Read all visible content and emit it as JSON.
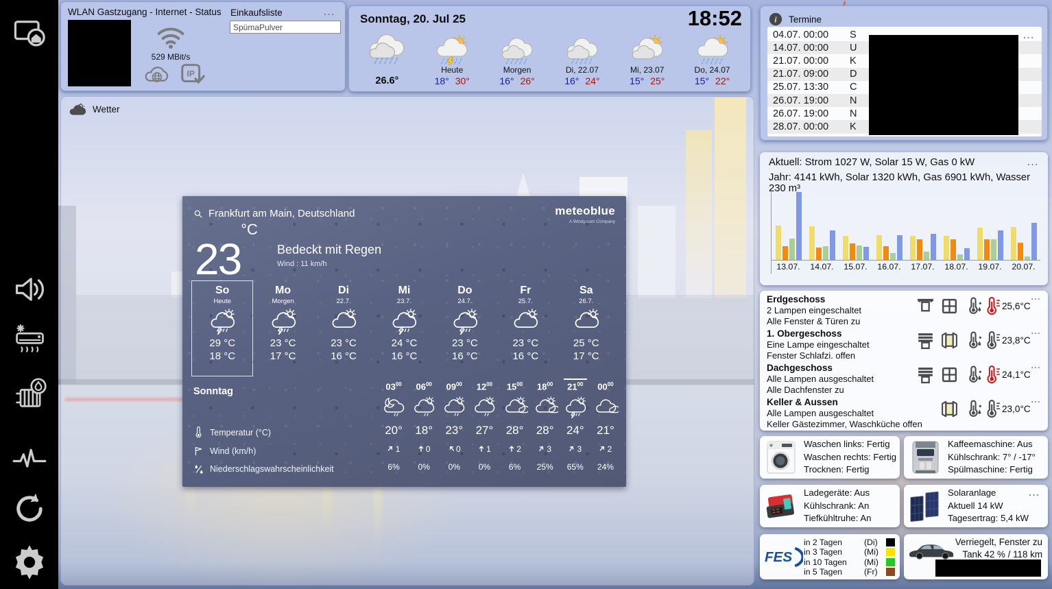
{
  "sidebar": {
    "items": [
      {
        "name": "sidebar-item-home-screen",
        "icon": "screen-home-icon"
      },
      {
        "name": "sidebar-item-audio",
        "icon": "speaker-icon"
      },
      {
        "name": "sidebar-item-climate",
        "icon": "ac-icon"
      },
      {
        "name": "sidebar-item-heating",
        "icon": "radiator-icon"
      },
      {
        "name": "sidebar-item-status",
        "icon": "pulse-icon"
      },
      {
        "name": "sidebar-item-reload",
        "icon": "refresh-icon"
      },
      {
        "name": "sidebar-item-settings",
        "icon": "gear-icon"
      }
    ]
  },
  "wlan_panel": {
    "title": "WLAN Gastzugang - Internet - Status",
    "speed": "529 MBit/s",
    "icons": {
      "wifi": "wifi-icon",
      "internet": "cloud-globe-icon",
      "ip": "ip-check-icon"
    }
  },
  "shopping": {
    "title": "Einkaufsliste",
    "menu": "...",
    "items": [
      "SpümaPulver"
    ]
  },
  "clock_panel": {
    "date": "Sonntag, 20. Jul 25",
    "time": "18:52",
    "current": {
      "icon": "t-rain-heavy",
      "temp": "26.6°"
    },
    "days": [
      {
        "label": "Heute",
        "min": "18°",
        "max": "30°",
        "icon": "t-sun-rain-thunder"
      },
      {
        "label": "Morgen",
        "min": "16°",
        "max": "26°",
        "icon": "t-clouds-rain"
      },
      {
        "label": "Di, 22.07",
        "min": "16°",
        "max": "24°",
        "icon": "t-clouds-rain"
      },
      {
        "label": "Mi, 23.07",
        "min": "15°",
        "max": "25°",
        "icon": "t-sun-clouds"
      },
      {
        "label": "Do, 24.07",
        "min": "15°",
        "max": "22°",
        "icon": "t-sun-rain"
      }
    ]
  },
  "wetter": {
    "label": "Wetter",
    "icon": "cloud-icon"
  },
  "meteoblue": {
    "search_icon": "search-icon",
    "location": "Frankfurt am Main, Deutschland",
    "logo": "meteoblue",
    "logo_sub": "A Windy.com Company",
    "temp": "23",
    "temp_unit": "°C",
    "condition": "Bedeckt mit Regen",
    "wind": "Wind : 11 km/h",
    "days": [
      {
        "name": "So",
        "sub": "Heute",
        "icon": "w-thunder",
        "max": "29 °C",
        "min": "18 °C",
        "selected": true
      },
      {
        "name": "Mo",
        "sub": "Morgen",
        "icon": "w-thunder",
        "max": "23 °C",
        "min": "17 °C"
      },
      {
        "name": "Di",
        "sub": "22.7.",
        "icon": "w-sun-cloud",
        "max": "23 °C",
        "min": "16 °C"
      },
      {
        "name": "Mi",
        "sub": "23.7.",
        "icon": "w-thunder",
        "max": "24 °C",
        "min": "16 °C"
      },
      {
        "name": "Do",
        "sub": "24.7.",
        "icon": "w-thunder",
        "max": "23 °C",
        "min": "16 °C"
      },
      {
        "name": "Fr",
        "sub": "25.7.",
        "icon": "w-sun-cloud",
        "max": "23 °C",
        "min": "16 °C"
      },
      {
        "name": "Sa",
        "sub": "26.7.",
        "icon": "w-sun-cloud",
        "max": "25 °C",
        "min": "17 °C"
      }
    ],
    "hourly_day": "Sonntag",
    "rows": {
      "temp_label": "Temperatur (°C)",
      "wind_label": "Wind (km/h)",
      "precip_label": "Niederschlagswahrscheinlichkeit"
    },
    "row_icons": {
      "temp": "w-thermo",
      "wind": "w-wind",
      "precip": "w-precip"
    },
    "hours": [
      {
        "time": "03",
        "sup": "00",
        "icon": "w-moon-rain",
        "temp": "20°",
        "wind": "1",
        "wind_dir": 45,
        "arrow": "w-arrow",
        "precip": "6%"
      },
      {
        "time": "06",
        "sup": "00",
        "icon": "w-sun-rain",
        "temp": "18°",
        "wind": "0",
        "wind_dir": 0,
        "arrow": "w-arrow",
        "precip": "0%"
      },
      {
        "time": "09",
        "sup": "00",
        "icon": "w-sun-rain",
        "temp": "23°",
        "wind": "0",
        "wind_dir": -40,
        "arrow": "w-arrow",
        "precip": "0%"
      },
      {
        "time": "12",
        "sup": "00",
        "icon": "w-sun-rain",
        "temp": "27°",
        "wind": "1",
        "wind_dir": 0,
        "arrow": "w-arrow",
        "precip": "0%"
      },
      {
        "time": "15",
        "sup": "00",
        "icon": "w-sun-clouds",
        "temp": "28°",
        "wind": "2",
        "wind_dir": 0,
        "arrow": "w-arrow",
        "precip": "6%"
      },
      {
        "time": "18",
        "sup": "00",
        "icon": "w-sun-clouds",
        "temp": "28°",
        "wind": "3",
        "wind_dir": 35,
        "arrow": "w-arrow",
        "precip": "25%"
      },
      {
        "time": "21",
        "sup": "00",
        "icon": "w-thunder",
        "temp": "24°",
        "wind": "3",
        "wind_dir": 35,
        "arrow": "w-arrow",
        "precip": "65%",
        "current": true
      },
      {
        "time": "00",
        "sup": "00",
        "icon": "w-clouds",
        "temp": "21°",
        "wind": "2",
        "wind_dir": 45,
        "arrow": "w-arrow",
        "precip": "24%"
      }
    ]
  },
  "termine": {
    "title": "Termine",
    "icon": "info-icon",
    "menu": "...",
    "redacted": true,
    "items": [
      {
        "datetime": "04.07. 00:00",
        "title_hint": "S"
      },
      {
        "datetime": "14.07. 00:00",
        "title_hint": "U"
      },
      {
        "datetime": "21.07. 00:00",
        "title_hint": "K"
      },
      {
        "datetime": "21.07. 09:00",
        "title_hint": "D"
      },
      {
        "datetime": "25.07. 13:30",
        "title_hint": "C"
      },
      {
        "datetime": "26.07. 19:00",
        "title_hint": "N"
      },
      {
        "datetime": "26.07. 19:00",
        "title_hint": "N"
      },
      {
        "datetime": "28.07. 00:00",
        "title_hint": "K"
      }
    ]
  },
  "energy": {
    "line1": "Aktuell: Strom 1027 W, Solar 15 W, Gas 0 kW",
    "line2": "Jahr: 4141 kWh, Solar 1320 kWh, Gas 6901 kWh, Wasser 230 m³",
    "menu": "..."
  },
  "chart_data": {
    "type": "bar",
    "categories": [
      "13.07.",
      "14.07.",
      "15.07.",
      "16.07.",
      "17.07.",
      "18.07.",
      "19.07.",
      "20.07."
    ],
    "series": [
      {
        "name": "yellow",
        "color": "#f0dc6a",
        "values": [
          51,
          50,
          35,
          36,
          35,
          35,
          47,
          48
        ]
      },
      {
        "name": "orange",
        "color": "#f08a10",
        "values": [
          20,
          18,
          24,
          20,
          30,
          30,
          30,
          25
        ]
      },
      {
        "name": "green",
        "color": "#a9cf96",
        "values": [
          31,
          20,
          21,
          10,
          12,
          8,
          30,
          5
        ]
      },
      {
        "name": "blue",
        "color": "#8099e2",
        "values": [
          100,
          43,
          19,
          36,
          38,
          17,
          43,
          55
        ]
      }
    ],
    "ylim": [
      0,
      100
    ],
    "xlabel": "",
    "ylabel": "",
    "legend": false
  },
  "floors": {
    "rows": [
      {
        "name": "Erdgeschoss",
        "line1": "2 Lampen eingeschaltet",
        "line2": "Alle Fenster & Türen zu",
        "icons": {
          "shutter": "shutter-open-icon",
          "window": "window-closed-icon",
          "sensor": "thermo-drops-icon",
          "thermo": "thermo-icon"
        },
        "alert": true,
        "temp": "25,6°C",
        "menu": "..."
      },
      {
        "name": "1. Obergeschoss",
        "line1": "Eine Lampe eingeschaltet",
        "line2": "Fenster Schlafzi. offen",
        "icons": {
          "shutter": "shutter-closed-icon",
          "window": "window-open-icon",
          "sensor": "thermo-drops-icon",
          "thermo": "thermo-icon"
        },
        "alert": false,
        "temp": "23,8°C",
        "menu": "..."
      },
      {
        "name": "Dachgeschoss",
        "line1": "Alle Lampen ausgeschaltet",
        "line2": "Alle Dachfenster zu",
        "icons": {
          "shutter": "shutter-closed-icon",
          "window": "window-closed-icon",
          "sensor": "thermo-drops-icon",
          "thermo": "thermo-icon"
        },
        "alert": true,
        "temp": "24,1°C",
        "menu": "..."
      },
      {
        "name": "Keller & Aussen",
        "line1": "Alle Lampen ausgeschaltet",
        "line2": "Keller Gästezimmer, Waschküche offen",
        "icons": {
          "window": "window-open-icon",
          "sensor": "thermo-drops-icon",
          "thermo": "thermo-icon"
        },
        "alert": false,
        "temp": "23,0°C",
        "menu": "..."
      }
    ]
  },
  "appliances": {
    "wash": {
      "image": "washer-image",
      "lines": [
        "Waschen links: Fertig",
        "Waschen rechts: Fertig",
        "Trocknen: Fertig"
      ]
    },
    "coffee": {
      "image": "coffee-image",
      "lines": [
        "Kaffeemaschine: Aus",
        "Kühlschrank: 7° / -17°",
        "Spülmaschine: Fertig"
      ]
    },
    "charge": {
      "image": "charger-image",
      "lines": [
        "Ladegeräte: Aus",
        "Kühlschrank: An",
        "Tiefkühltruhe: An"
      ]
    },
    "solar": {
      "image": "solar-image",
      "title": "Solaranlage",
      "menu": "...",
      "lines": [
        "Aktuell 14 kW",
        "Tagesertrag: 5,4 kW"
      ]
    }
  },
  "waste": {
    "logo": "fes-logo",
    "rows": [
      {
        "label": "in 2 Tagen",
        "day": "(Di)",
        "color": "#000000"
      },
      {
        "label": "in 3 Tagen",
        "day": "(Mi)",
        "color": "#f7e400"
      },
      {
        "label": "in 10 Tagen",
        "day": "(Mi)",
        "color": "#2bc42a"
      },
      {
        "label": "in 5 Tagen",
        "day": "(Fr)",
        "color": "#8a4a1e"
      }
    ]
  },
  "car": {
    "image": "car-image",
    "line1": "Verriegelt, Fenster zu",
    "line2": "Tank 42 % / 118 km",
    "redacted": true
  }
}
